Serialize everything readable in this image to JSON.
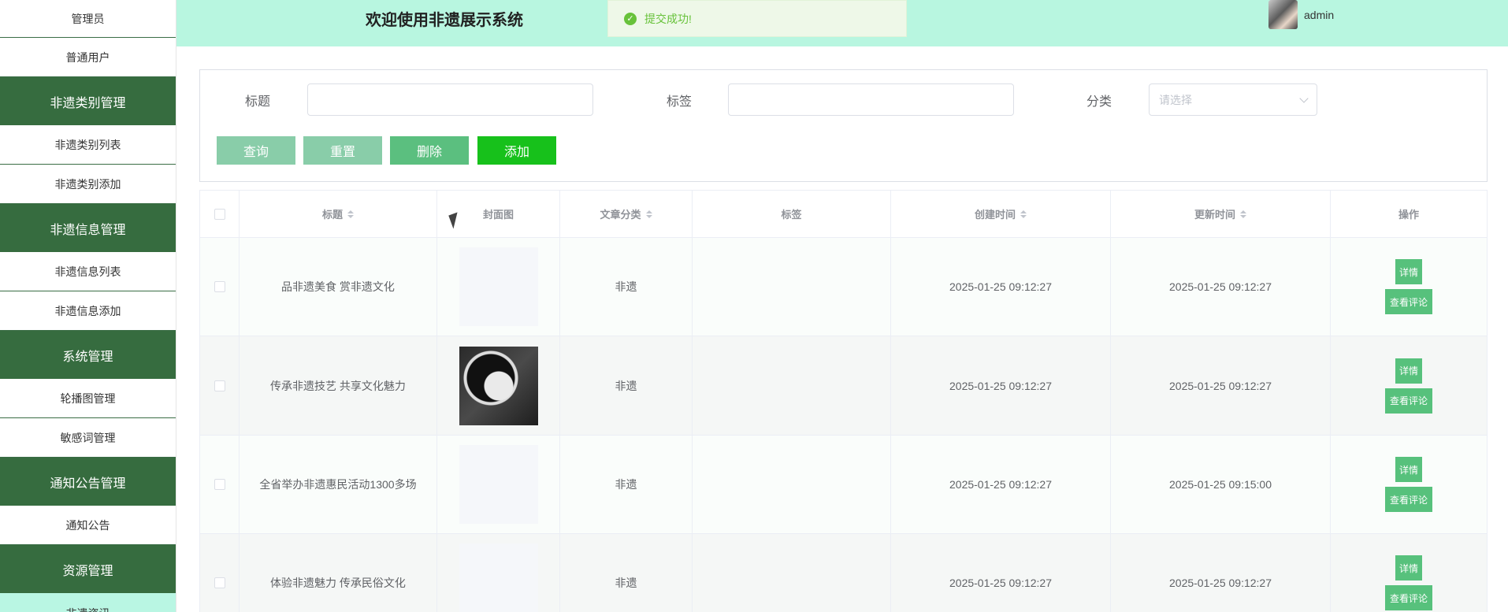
{
  "sidebar": {
    "items": [
      {
        "label": "管理员",
        "type": "item"
      },
      {
        "label": "普通用户",
        "type": "item"
      },
      {
        "label": "非遗类别管理",
        "type": "group"
      },
      {
        "label": "非遗类别列表",
        "type": "item"
      },
      {
        "label": "非遗类别添加",
        "type": "item"
      },
      {
        "label": "非遗信息管理",
        "type": "group"
      },
      {
        "label": "非遗信息列表",
        "type": "item"
      },
      {
        "label": "非遗信息添加",
        "type": "item"
      },
      {
        "label": "系统管理",
        "type": "group"
      },
      {
        "label": "轮播图管理",
        "type": "item"
      },
      {
        "label": "敏感词管理",
        "type": "item"
      },
      {
        "label": "通知公告管理",
        "type": "group"
      },
      {
        "label": "通知公告",
        "type": "item"
      },
      {
        "label": "资源管理",
        "type": "group"
      },
      {
        "label": "非遗资讯",
        "type": "item"
      }
    ]
  },
  "header": {
    "title": "欢迎使用非遗展示系统",
    "toast": "提交成功!",
    "username": "admin"
  },
  "search": {
    "title_label": "标题",
    "title_value": "",
    "tag_label": "标签",
    "tag_value": "",
    "category_label": "分类",
    "category_placeholder": "请选择",
    "buttons": {
      "query": "查询",
      "reset": "重置",
      "delete": "删除",
      "add": "添加"
    }
  },
  "table": {
    "headers": [
      "标题",
      "封面图",
      "文章分类",
      "标签",
      "创建时间",
      "更新时间",
      "操作"
    ],
    "rows": [
      {
        "title": "品非遗美食 赏非遗文化",
        "cover": "none",
        "category": "非遗",
        "tag": "",
        "created": "2025-01-25 09:12:27",
        "updated": "2025-01-25 09:12:27"
      },
      {
        "title": "传承非遗技艺 共享文化魅力",
        "cover": "image",
        "category": "非遗",
        "tag": "",
        "created": "2025-01-25 09:12:27",
        "updated": "2025-01-25 09:12:27"
      },
      {
        "title": "全省举办非遗惠民活动1300多场",
        "cover": "none",
        "category": "非遗",
        "tag": "",
        "created": "2025-01-25 09:12:27",
        "updated": "2025-01-25 09:15:00"
      },
      {
        "title": "体验非遗魅力 传承民俗文化",
        "cover": "none",
        "category": "非遗",
        "tag": "",
        "created": "2025-01-25 09:12:27",
        "updated": "2025-01-25 09:12:27"
      }
    ],
    "actions": {
      "detail": "详情",
      "comments": "查看评论"
    }
  },
  "colors": {
    "sidebar_group": "#366c3f",
    "header_bg": "#b8f6e0",
    "accent_green": "#57c17c",
    "add_button": "#17c11b"
  }
}
